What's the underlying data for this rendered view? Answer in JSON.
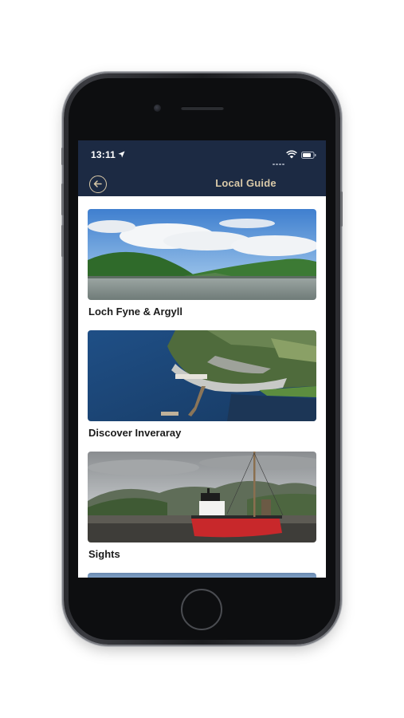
{
  "status_bar": {
    "time": "13:11"
  },
  "header": {
    "title": "Local Guide"
  },
  "cards": [
    {
      "label": "Loch Fyne & Argyll"
    },
    {
      "label": "Discover Inveraray"
    },
    {
      "label": "Sights"
    }
  ],
  "icons": {
    "location": "location-arrow-icon",
    "wifi": "wifi-icon",
    "battery": "battery-icon",
    "back": "back-arrow-icon"
  },
  "colors": {
    "header_bg": "#1c2a43",
    "title_accent": "#d9c9a8",
    "boat_red": "#c8282b"
  }
}
